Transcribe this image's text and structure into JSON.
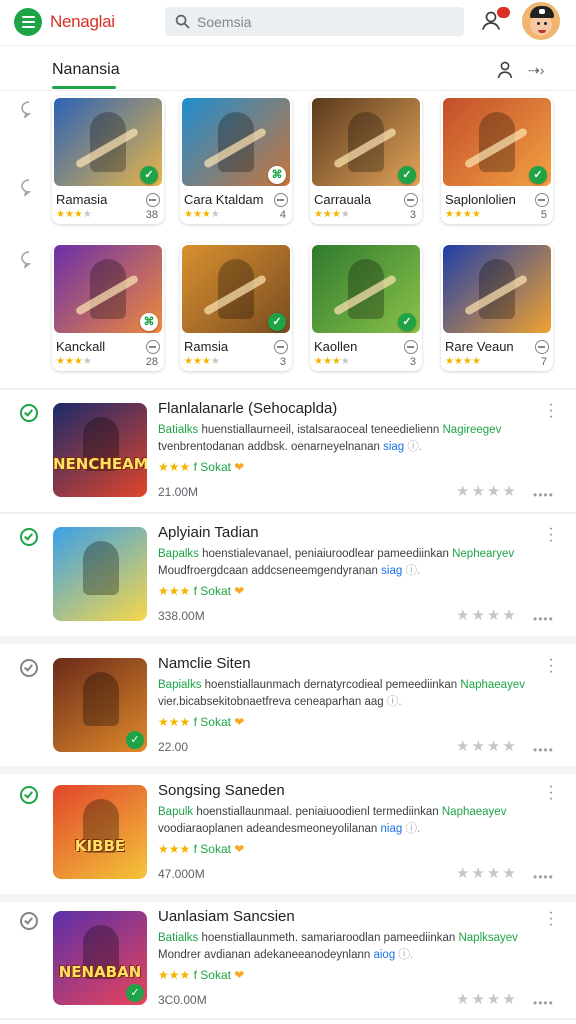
{
  "header": {
    "title": "Nenaglai",
    "search_placeholder": "Soemsia",
    "notification_badge": "",
    "colors": {
      "accent": "#1ea446",
      "title": "#d93025"
    }
  },
  "section": {
    "title": "Nanansia"
  },
  "grid": [
    {
      "name": "Ramasia",
      "count": "38",
      "rating": 3,
      "corner": "check",
      "colors": [
        "#2b62b5",
        "#e8b54a"
      ]
    },
    {
      "name": "Cara Ktaldam",
      "count": "4",
      "rating": 3,
      "corner": "ap",
      "colors": [
        "#1f8ed1",
        "#c8743a"
      ]
    },
    {
      "name": "Carrauala",
      "count": "3",
      "rating": 3,
      "corner": "check",
      "colors": [
        "#5a3a1e",
        "#e3a45a"
      ]
    },
    {
      "name": "Saplonlolien",
      "count": "5",
      "rating": 4,
      "corner": "check",
      "colors": [
        "#c34d2a",
        "#f2a243"
      ]
    },
    {
      "name": "Kanckall",
      "count": "28",
      "rating": 3,
      "corner": "ap",
      "colors": [
        "#6a2fa8",
        "#f08a3c"
      ]
    },
    {
      "name": "Ramsia",
      "count": "3",
      "rating": 3,
      "corner": "check",
      "colors": [
        "#d9912f",
        "#7a4c22"
      ]
    },
    {
      "name": "Kaollen",
      "count": "3",
      "rating": 3,
      "corner": "check",
      "colors": [
        "#2f7a2f",
        "#8bc34a"
      ]
    },
    {
      "name": "Rare Veaun",
      "count": "7",
      "rating": 4,
      "corner": "none",
      "colors": [
        "#1f3ea8",
        "#f0a230"
      ]
    }
  ],
  "list": [
    {
      "title": "Flanlalanarle (Sehocaplda)",
      "desc_green": "Batialks",
      "desc_mid": " huenstiallaurneeil, istalsaraoceal teneedielienn ",
      "desc_green2": "Nagireegev",
      "desc_line2": "tvenbrentodanan addbsk. oenarneyelnanan ",
      "desc_blue": "siag",
      "rating_label": "f Sokat",
      "size": "21.00M",
      "thumb_word": "NENCHEAM",
      "thumb_colors": [
        "#1b2a6b",
        "#e0452b"
      ],
      "status": "green",
      "has_check": false
    },
    {
      "title": "Aplyiain Tadian",
      "desc_green": "Bapalks",
      "desc_mid": " hoenstialevanael, peniaiuroodlear pameediinkan ",
      "desc_green2": "Nephearyev",
      "desc_line2": "Moudfroergdcaan addcseneemgendyranan ",
      "desc_blue": "siag",
      "rating_label": "f Sokat",
      "size": "338.00M",
      "thumb_word": "",
      "thumb_colors": [
        "#3aa0e8",
        "#f7d74a"
      ],
      "status": "green",
      "has_check": false
    },
    {
      "title": "Namclie Siten",
      "desc_green": "Bapialks",
      "desc_mid": " hoenstiallaunmach dernatyrcodieal pemeediinkan ",
      "desc_green2": "Naphaeayev",
      "desc_line2": "vier.bicabsekitobnaetfreva ceneaparhan aag",
      "desc_blue": "",
      "rating_label": "f Sokat",
      "size": "22.00",
      "thumb_word": "",
      "thumb_colors": [
        "#6b2a1a",
        "#e08a2a"
      ],
      "status": "gray",
      "has_check": true
    },
    {
      "title": "Songsing Saneden",
      "desc_green": "Bapulk",
      "desc_mid": " hoenstiallaunmaal. peniaiuoodienl termediinkan ",
      "desc_green2": "Naphaeayev",
      "desc_line2": "voodiaraoplanen adeandesmeoneyolilanan ",
      "desc_blue": "niag",
      "rating_label": "f Sokat",
      "size": "47.000M",
      "thumb_word": "KIBBE",
      "thumb_colors": [
        "#e0452b",
        "#f4c53a"
      ],
      "status": "green",
      "has_check": false
    },
    {
      "title": "Uanlasiam Sancsien",
      "desc_green": "Batialks",
      "desc_mid": " hoenstiallaunmeth. samariaroodlan pameediinkan ",
      "desc_green2": "Naplksayev",
      "desc_line2": "Mondrer avdianan adekaneeanodeynlann ",
      "desc_blue": "aiog",
      "rating_label": "f Sokat",
      "size": "3C0.00M",
      "thumb_word": "NENABAN",
      "thumb_colors": [
        "#5a2fa8",
        "#e8445a"
      ],
      "status": "gray",
      "has_check": true
    }
  ]
}
